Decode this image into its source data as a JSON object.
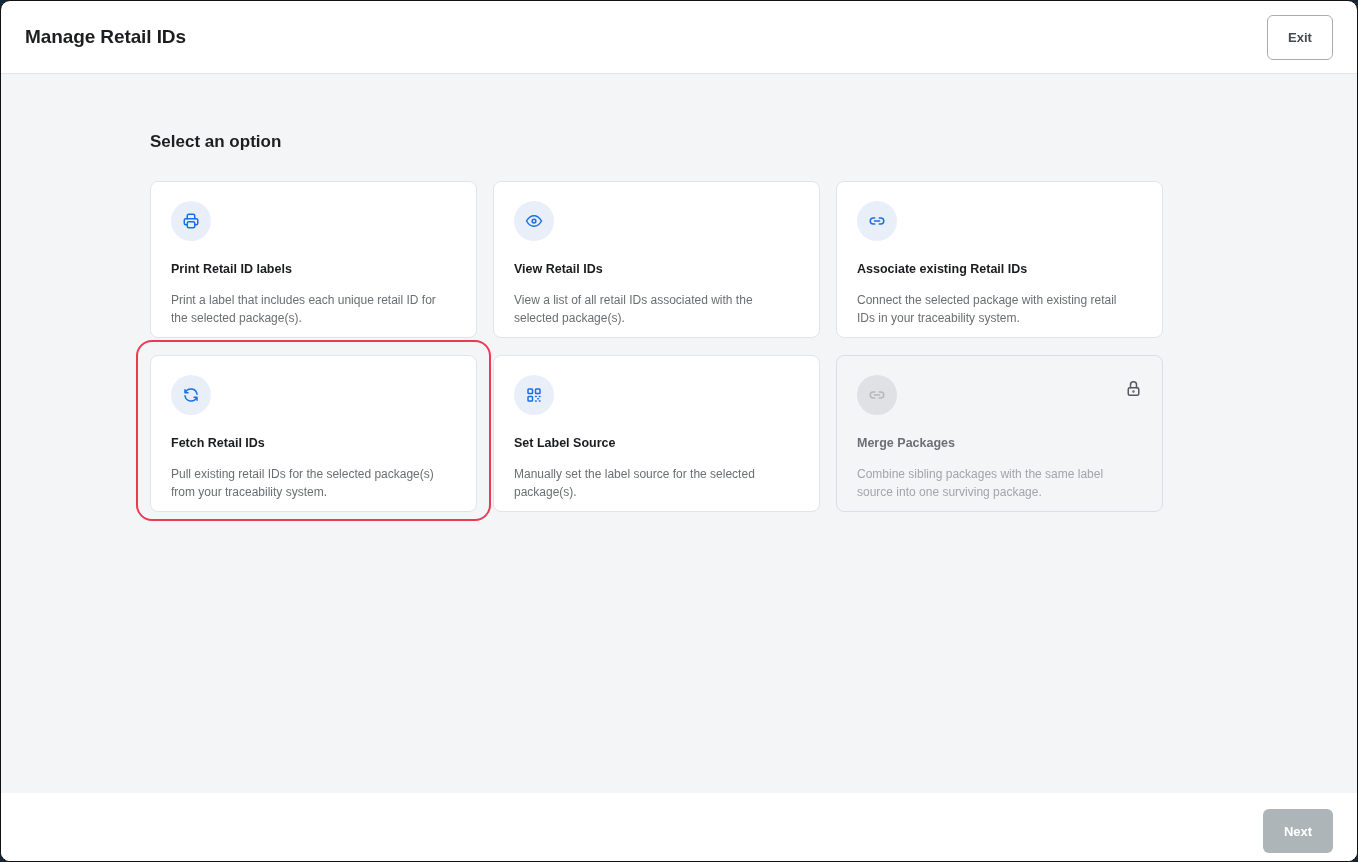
{
  "window": {
    "title": "Manage Retail IDs",
    "exit_button": "Exit"
  },
  "heading": "Select an option",
  "options": [
    {
      "kind": "print",
      "title": "Print Retail ID labels",
      "description": "Print a label that includes each unique retail ID for the selected package(s).",
      "selected": false,
      "disabled": false
    },
    {
      "kind": "view",
      "title": "View Retail IDs",
      "description": "View a list of all retail IDs associated with the selected package(s).",
      "selected": false,
      "disabled": false
    },
    {
      "kind": "associate",
      "title": "Associate existing Retail IDs",
      "description": "Connect the selected package with existing retail IDs in your traceability system.",
      "selected": false,
      "disabled": false
    },
    {
      "kind": "fetch",
      "title": "Fetch Retail IDs",
      "description": "Pull existing retail IDs for the selected package(s) from your traceability system.",
      "selected": true,
      "disabled": false
    },
    {
      "kind": "label-source",
      "title": "Set Label Source",
      "description": "Manually set the label source for the selected package(s).",
      "selected": false,
      "disabled": false
    },
    {
      "kind": "merge",
      "title": "Merge Packages",
      "description": "Combine sibling packages with the same label source into one surviving package.",
      "selected": false,
      "disabled": true
    }
  ],
  "footer": {
    "next_button": {
      "label": "Next",
      "disabled": true
    }
  }
}
